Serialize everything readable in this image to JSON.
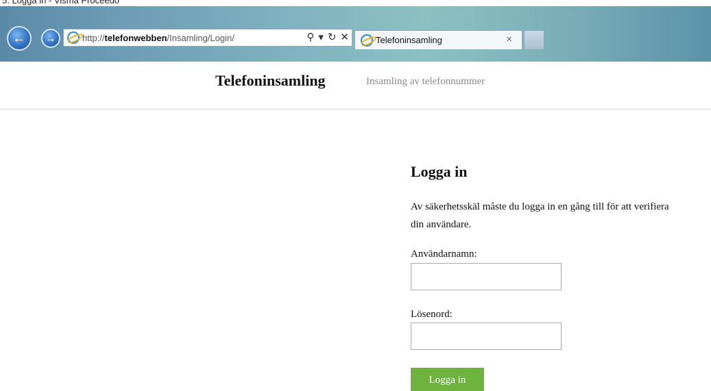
{
  "window": {
    "caption": "5. Logga in - Visma Proceedo"
  },
  "browser": {
    "address_prefix": "http://",
    "address_host": "telefonwebben",
    "address_path": "/Insamling/Login/",
    "search_glyph": "⚲",
    "dropdown_glyph": "▾",
    "refresh_glyph": "↻",
    "stop_glyph": "✕",
    "back_glyph": "←",
    "forward_glyph": "→",
    "tab_title": "Telefoninsamling",
    "tab_close_glyph": "×"
  },
  "site": {
    "brand": "Telefoninsamling",
    "tagline": "Insamling av telefonnummer"
  },
  "login": {
    "heading": "Logga in",
    "description": "Av säkerhetsskäl måste du logga in en gång till för att verifiera din användare.",
    "username_label": "Användarnamn:",
    "username_value": "",
    "password_label": "Lösenord:",
    "password_value": "",
    "submit_label": "Logga in"
  },
  "colors": {
    "accent_button": "#6fb33f",
    "tagline": "#8a8a8a"
  },
  "icons": {
    "back": "back-arrow-icon",
    "forward": "forward-arrow-icon",
    "page": "internet-explorer-icon"
  }
}
